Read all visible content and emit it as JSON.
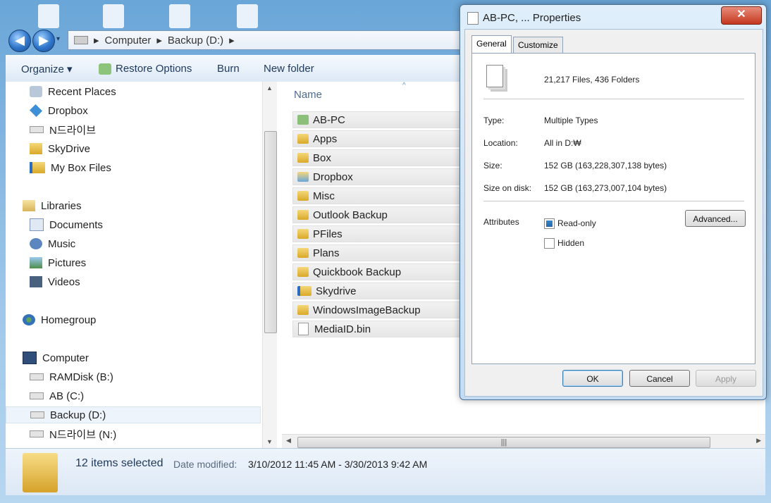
{
  "explorer": {
    "address": {
      "path": [
        "Computer",
        "Backup (D:)"
      ]
    },
    "toolbar": {
      "organize": "Organize ▾",
      "restore": "Restore Options",
      "burn": "Burn",
      "new_folder": "New folder"
    },
    "nav": {
      "items": [
        {
          "label": "Recent Places",
          "icon": "recent-places-icon"
        },
        {
          "label": "Dropbox",
          "icon": "dropbox-icon"
        },
        {
          "label": "N드라이브",
          "icon": "drive-icon"
        },
        {
          "label": "SkyDrive",
          "icon": "folder-icon"
        },
        {
          "label": "My Box Files",
          "icon": "box-icon"
        },
        {
          "label": "Libraries",
          "icon": "library-icon"
        },
        {
          "label": "Documents",
          "icon": "documents-icon"
        },
        {
          "label": "Music",
          "icon": "music-icon"
        },
        {
          "label": "Pictures",
          "icon": "pictures-icon"
        },
        {
          "label": "Videos",
          "icon": "videos-icon"
        },
        {
          "label": "Homegroup",
          "icon": "homegroup-icon"
        },
        {
          "label": "Computer",
          "icon": "computer-icon"
        },
        {
          "label": "RAMDisk (B:)",
          "icon": "drive-icon"
        },
        {
          "label": "AB (C:)",
          "icon": "drive-icon"
        },
        {
          "label": "Backup (D:)",
          "icon": "drive-icon"
        },
        {
          "label": "N드라이브 (N:)",
          "icon": "drive-icon"
        }
      ]
    },
    "content": {
      "column_name": "Name",
      "files": [
        "AB-PC",
        "Apps",
        "Box",
        "Dropbox",
        "Misc",
        "Outlook Backup",
        "PFiles",
        "Plans",
        "Quickbook Backup",
        "Skydrive",
        "WindowsImageBackup",
        "MediaID.bin"
      ]
    },
    "status": {
      "count": "12 items selected",
      "date_label": "Date modified:",
      "date_value": "3/10/2012 11:45 AM - 3/30/2013 9:42 AM"
    }
  },
  "dialog": {
    "title": "AB-PC, ... Properties",
    "close": "✕",
    "tabs": {
      "general": "General",
      "customize": "Customize"
    },
    "summary": "21,217 Files, 436 Folders",
    "rows": {
      "type_label": "Type:",
      "type_value": "Multiple Types",
      "location_label": "Location:",
      "location_value": "All in D:₩",
      "size_label": "Size:",
      "size_value": "152 GB (163,228,307,138 bytes)",
      "disk_label": "Size on disk:",
      "disk_value": "152 GB (163,273,007,104 bytes)"
    },
    "attributes": {
      "label": "Attributes",
      "readonly": "Read-only",
      "hidden": "Hidden",
      "advanced": "Advanced..."
    },
    "buttons": {
      "ok": "OK",
      "cancel": "Cancel",
      "apply": "Apply"
    }
  }
}
